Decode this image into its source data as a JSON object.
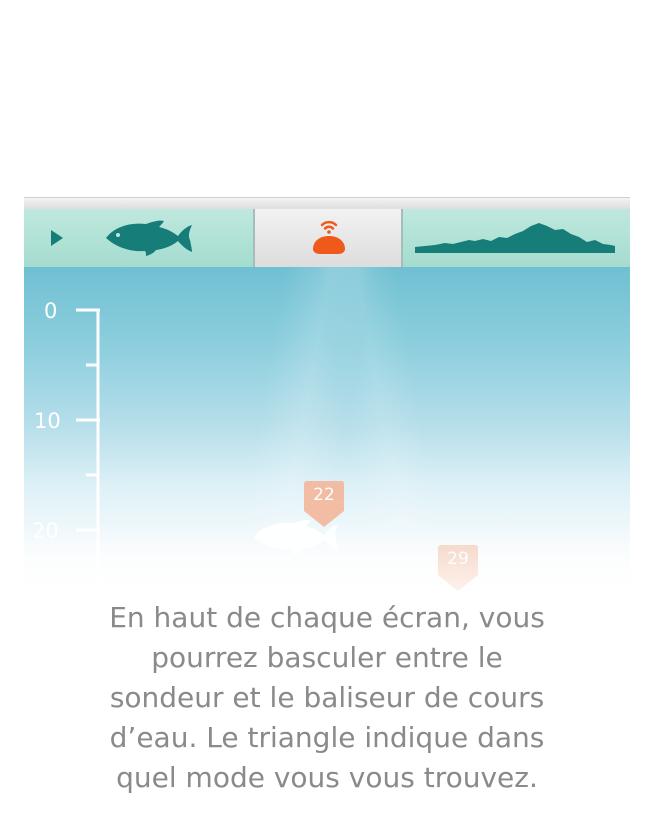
{
  "tabs": [
    {
      "name": "sonar",
      "icon": "fish-icon",
      "active": true
    },
    {
      "name": "device",
      "icon": "sonar-device-icon",
      "active": false
    },
    {
      "name": "riverbed-mapper",
      "icon": "depth-profile-icon",
      "active": false
    }
  ],
  "mode_indicator_icon": "triangle-right-icon",
  "depth_scale": {
    "labels": [
      "0",
      "10",
      "20"
    ]
  },
  "markers": [
    {
      "value": "22"
    },
    {
      "value": "29"
    }
  ],
  "caption": {
    "lines": [
      "En haut de chaque écran, vous",
      "pourrez basculer entre le",
      "sondeur et le baliseur de cours",
      "d’eau. Le triangle indique dans",
      "quel mode vous vous trouvez."
    ]
  },
  "colors": {
    "accent_teal": "#167d78",
    "tab_teal": "#b9e3da",
    "device_orange": "#ef5a1c",
    "marker_orange": "#f0a07a",
    "caption_gray": "#8a8a8a"
  }
}
